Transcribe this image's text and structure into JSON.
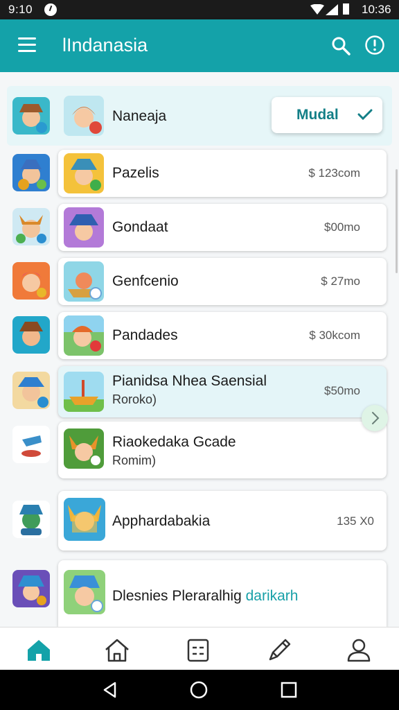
{
  "status_bar": {
    "time_left": "9:10",
    "time_right": "10:36",
    "icons": [
      "clock-icon",
      "wifi-icon",
      "signal-icon",
      "battery-icon"
    ]
  },
  "app_bar": {
    "title": "lIndanasia",
    "icons": [
      "menu-icon",
      "search-icon",
      "info-icon"
    ]
  },
  "header_item": {
    "name": "Naneaja",
    "button_label": "Mudal",
    "button_icon": "check-icon"
  },
  "items": [
    {
      "name": "Pazelis",
      "price": "$ 123com"
    },
    {
      "name": "Gondaat",
      "price": "$00mo"
    },
    {
      "name": "Genfcenio",
      "price": "$ 27mo"
    },
    {
      "name": "Pandades",
      "price": "$ 30kcom"
    },
    {
      "name": "Pianidsa Nhea Saensial",
      "sub": "Roroko)",
      "price": "$50mo"
    },
    {
      "name": "Riaokedaka Gcade",
      "sub": "Romim)"
    },
    {
      "name": "Apphardabakia",
      "price": "135 X0"
    },
    {
      "name": "Dlesnies Pleraralhig",
      "name_accent": "darikarh"
    }
  ],
  "bottom_nav": [
    "home-icon",
    "house-outline-icon",
    "list-card-icon",
    "pen-icon",
    "profile-icon"
  ],
  "system_nav": [
    "back-icon",
    "home-circle-icon",
    "recents-icon"
  ],
  "colors": {
    "accent": "#14a2a9",
    "accent_dark": "#137f87",
    "selected_bg": "#e4f5f8",
    "status_bar": "#1b1b1b"
  }
}
